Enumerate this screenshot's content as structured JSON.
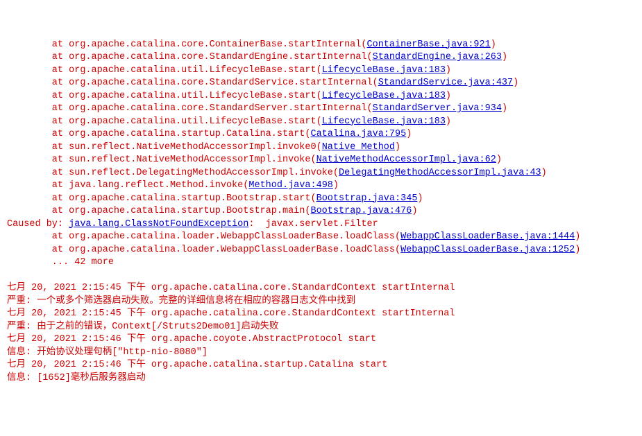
{
  "stack": [
    {
      "method": "org.apache.catalina.core.ContainerBase.startInternal",
      "loc": "ContainerBase.java:921"
    },
    {
      "method": "org.apache.catalina.core.StandardEngine.startInternal",
      "loc": "StandardEngine.java:263"
    },
    {
      "method": "org.apache.catalina.util.LifecycleBase.start",
      "loc": "LifecycleBase.java:183"
    },
    {
      "method": "org.apache.catalina.core.StandardService.startInternal",
      "loc": "StandardService.java:437"
    },
    {
      "method": "org.apache.catalina.util.LifecycleBase.start",
      "loc": "LifecycleBase.java:183"
    },
    {
      "method": "org.apache.catalina.core.StandardServer.startInternal",
      "loc": "StandardServer.java:934"
    },
    {
      "method": "org.apache.catalina.util.LifecycleBase.start",
      "loc": "LifecycleBase.java:183"
    },
    {
      "method": "org.apache.catalina.startup.Catalina.start",
      "loc": "Catalina.java:795"
    },
    {
      "method": "sun.reflect.NativeMethodAccessorImpl.invoke0",
      "loc": "Native Method"
    },
    {
      "method": "sun.reflect.NativeMethodAccessorImpl.invoke",
      "loc": "NativeMethodAccessorImpl.java:62"
    },
    {
      "method": "sun.reflect.DelegatingMethodAccessorImpl.invoke",
      "loc": "DelegatingMethodAccessorImpl.java:43"
    },
    {
      "method": "java.lang.reflect.Method.invoke",
      "loc": "Method.java:498"
    },
    {
      "method": "org.apache.catalina.startup.Bootstrap.start",
      "loc": "Bootstrap.java:345"
    },
    {
      "method": "org.apache.catalina.startup.Bootstrap.main",
      "loc": "Bootstrap.java:476"
    }
  ],
  "caused_by": {
    "label": "Caused by: ",
    "exception": "java.lang.ClassNotFoundException",
    "rest": ":  javax.servlet.Filter"
  },
  "cause_stack": [
    {
      "method": "org.apache.catalina.loader.WebappClassLoaderBase.loadClass",
      "loc": "WebappClassLoaderBase.java:1444"
    },
    {
      "method": "org.apache.catalina.loader.WebappClassLoaderBase.loadClass",
      "loc": "WebappClassLoaderBase.java:1252"
    }
  ],
  "more_line": "        ... 42 more",
  "blank": "",
  "log_lines": [
    "七月 20, 2021 2:15:45 下午 org.apache.catalina.core.StandardContext startInternal",
    "严重: 一个或多个筛选器启动失败。完整的详细信息将在相应的容器日志文件中找到",
    "七月 20, 2021 2:15:45 下午 org.apache.catalina.core.StandardContext startInternal",
    "严重: 由于之前的错误，Context[/Struts2Demo01]启动失败",
    "七月 20, 2021 2:15:46 下午 org.apache.coyote.AbstractProtocol start",
    "信息: 开始协议处理句柄[\"http-nio-8080\"]",
    "七月 20, 2021 2:15:46 下午 org.apache.catalina.startup.Catalina start",
    "信息: [1652]毫秒后服务器启动"
  ],
  "indent": "        at ",
  "open": "(",
  "close": ")"
}
